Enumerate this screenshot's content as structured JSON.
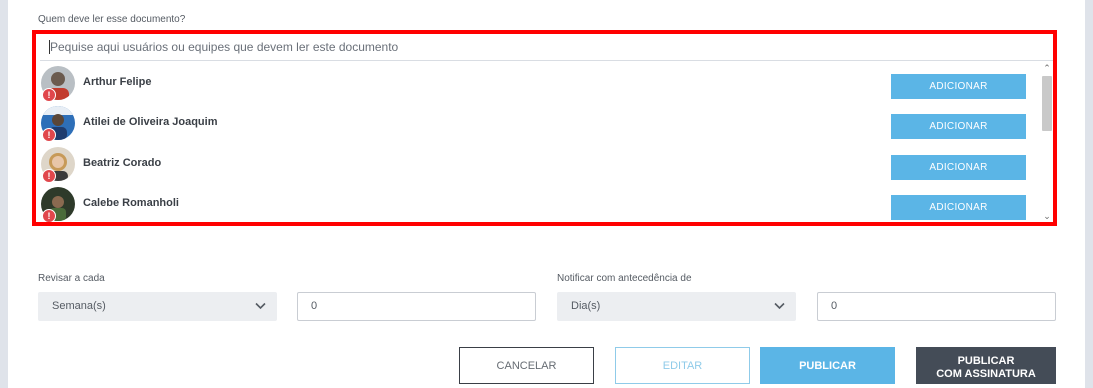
{
  "readers": {
    "label": "Quem deve ler esse documento?",
    "search_placeholder": "Pequise aqui usuários ou equipes que devem ler este documento",
    "add_label": "ADICIONAR",
    "users": [
      {
        "name": "Arthur Felipe",
        "avatar_color": "#9aa3a8",
        "warning": "!"
      },
      {
        "name": "Atilei de Oliveira Joaquim",
        "avatar_color": "#2e6fb8",
        "warning": "!"
      },
      {
        "name": "Beatriz Corado",
        "avatar_color": "#c8a27a",
        "warning": "!"
      },
      {
        "name": "Calebe Romanholi",
        "avatar_color": "#2e3a2a",
        "warning": "!"
      }
    ]
  },
  "review": {
    "label": "Revisar a cada",
    "unit_value": "Semana(s)",
    "amount_value": "0"
  },
  "notify": {
    "label": "Notificar com antecedência de",
    "unit_value": "Dia(s)",
    "amount_value": "0"
  },
  "actions": {
    "cancel": "CANCELAR",
    "edit": "EDITAR",
    "publish": "PUBLICAR",
    "publish_sign_line1": "PUBLICAR",
    "publish_sign_line2": "COM ASSINATURA"
  },
  "colors": {
    "highlight": "#ff0000",
    "accent": "#5bb5e6",
    "dark_button": "#444c57",
    "warning": "#e0474c"
  }
}
